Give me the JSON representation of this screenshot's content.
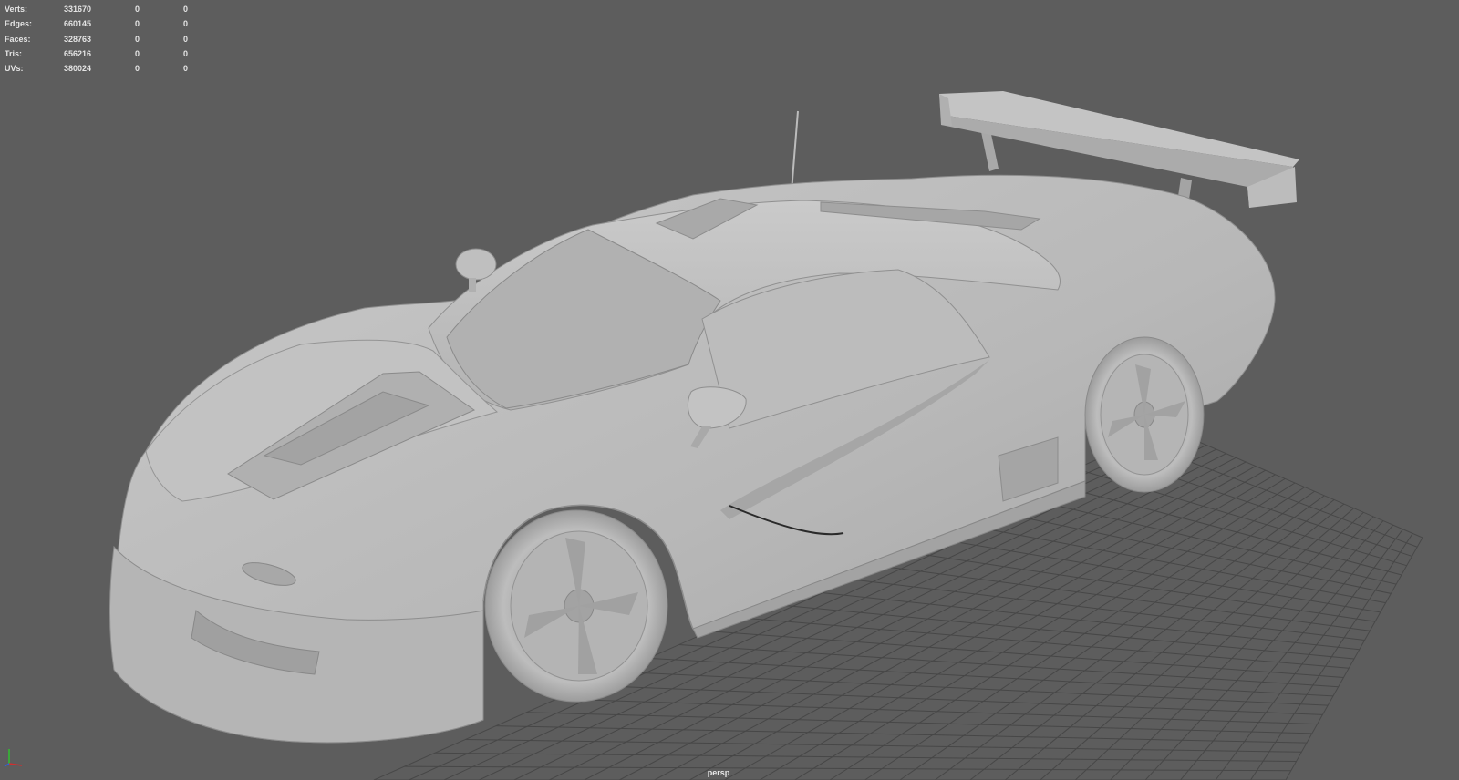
{
  "hud": {
    "rows": [
      {
        "label": "Verts:",
        "total": "331670",
        "selected": "0",
        "components": "0"
      },
      {
        "label": "Edges:",
        "total": "660145",
        "selected": "0",
        "components": "0"
      },
      {
        "label": "Faces:",
        "total": "328763",
        "selected": "0",
        "components": "0"
      },
      {
        "label": "Tris:",
        "total": "656216",
        "selected": "0",
        "components": "0"
      },
      {
        "label": "UVs:",
        "total": "380024",
        "selected": "0",
        "components": "0"
      }
    ]
  },
  "viewport": {
    "camera": "persp",
    "background": "#5d5d5d",
    "grid_color": "#474747",
    "model_color": "#b9b9b9"
  },
  "axis_gizmo": {
    "x_color": "#d03030",
    "y_color": "#30c030",
    "z_color": "#3060e0"
  }
}
